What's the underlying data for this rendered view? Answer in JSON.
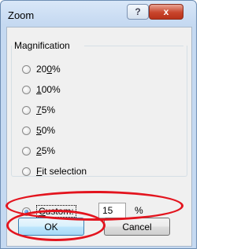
{
  "window": {
    "title": "Zoom",
    "help_glyph": "?",
    "close_glyph": "x"
  },
  "magnification": {
    "label": "Magnification",
    "options": [
      {
        "pre": "20",
        "key": "0",
        "post": "%",
        "checked": false
      },
      {
        "pre": "",
        "key": "1",
        "post": "00%",
        "checked": false
      },
      {
        "pre": "",
        "key": "7",
        "post": "5%",
        "checked": false
      },
      {
        "pre": "",
        "key": "5",
        "post": "0%",
        "checked": false
      },
      {
        "pre": "",
        "key": "2",
        "post": "5%",
        "checked": false
      },
      {
        "pre": "",
        "key": "F",
        "post": "it selection",
        "checked": false
      }
    ],
    "custom": {
      "pre": "",
      "key": "C",
      "post": "ustom:",
      "value": "15",
      "unit": "%",
      "checked": true
    }
  },
  "buttons": {
    "ok": "OK",
    "cancel": "Cancel"
  },
  "annotation_color": "#e3141e"
}
